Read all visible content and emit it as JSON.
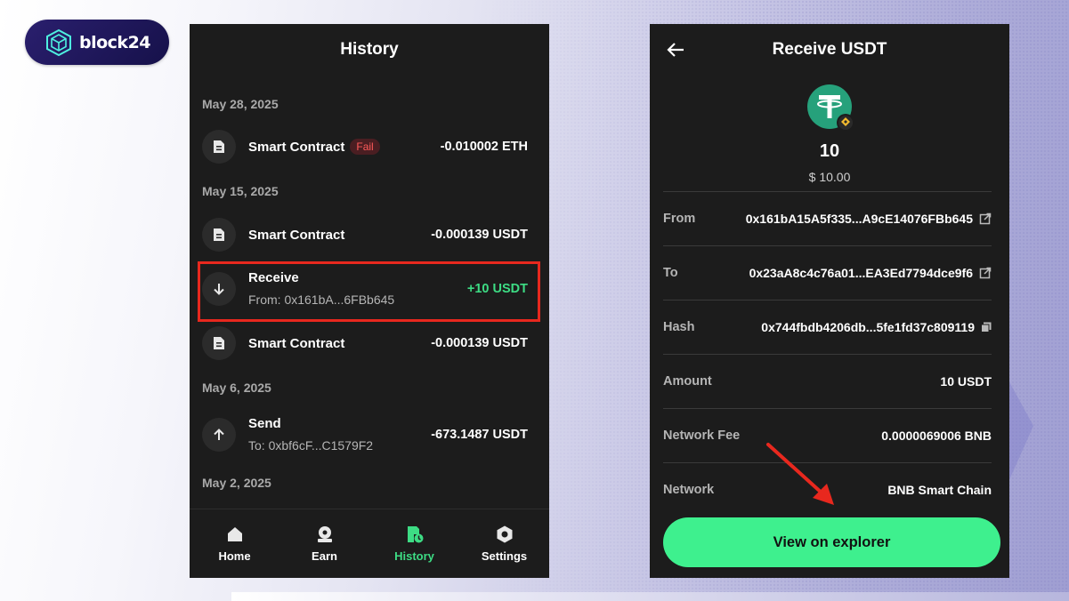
{
  "logo": {
    "text": "block24"
  },
  "history": {
    "title": "History",
    "groups": [
      {
        "date": "May 28, 2025"
      },
      {
        "date": "May 15, 2025"
      },
      {
        "date": "May 6, 2025"
      },
      {
        "date": "May 2, 2025"
      }
    ],
    "items": [
      {
        "title": "Smart Contract",
        "badge": "Fail",
        "amount": "-0.010002 ETH",
        "icon": "document-icon"
      },
      {
        "title": "Smart Contract",
        "amount": "-0.000139 USDT",
        "icon": "document-icon"
      },
      {
        "title": "Receive",
        "subtitle": "From: 0x161bA...6FBb645",
        "amount": "+10 USDT",
        "icon": "arrow-down-icon"
      },
      {
        "title": "Smart Contract",
        "amount": "-0.000139 USDT",
        "icon": "document-icon"
      },
      {
        "title": "Send",
        "subtitle": "To: 0xbf6cF...C1579F2",
        "amount": "-673.1487 USDT",
        "icon": "arrow-up-icon"
      }
    ],
    "nav": [
      {
        "label": "Home",
        "icon": "home-icon"
      },
      {
        "label": "Earn",
        "icon": "earn-icon"
      },
      {
        "label": "History",
        "icon": "history-icon",
        "active": true
      },
      {
        "label": "Settings",
        "icon": "settings-icon"
      }
    ]
  },
  "receive": {
    "title": "Receive USDT",
    "amount": "10",
    "usd": "$ 10.00",
    "details": [
      {
        "label": "From",
        "value": "0x161bA15A5f335...A9cE14076FBb645",
        "icon": "external-link-icon"
      },
      {
        "label": "To",
        "value": "0x23aA8c4c76a01...EA3Ed7794dce9f6",
        "icon": "external-link-icon"
      },
      {
        "label": "Hash",
        "value": "0x744fbdb4206db...5fe1fd37c809119",
        "icon": "copy-icon"
      },
      {
        "label": "Amount",
        "value": "10 USDT"
      },
      {
        "label": "Network Fee",
        "value": "0.0000069006 BNB"
      },
      {
        "label": "Network",
        "value": "BNB Smart Chain"
      }
    ],
    "button": "View on explorer"
  },
  "colors": {
    "accent": "#3ddc84",
    "button": "#3ef08e",
    "highlight": "#e8281e",
    "fail": "#ff5a5a"
  }
}
